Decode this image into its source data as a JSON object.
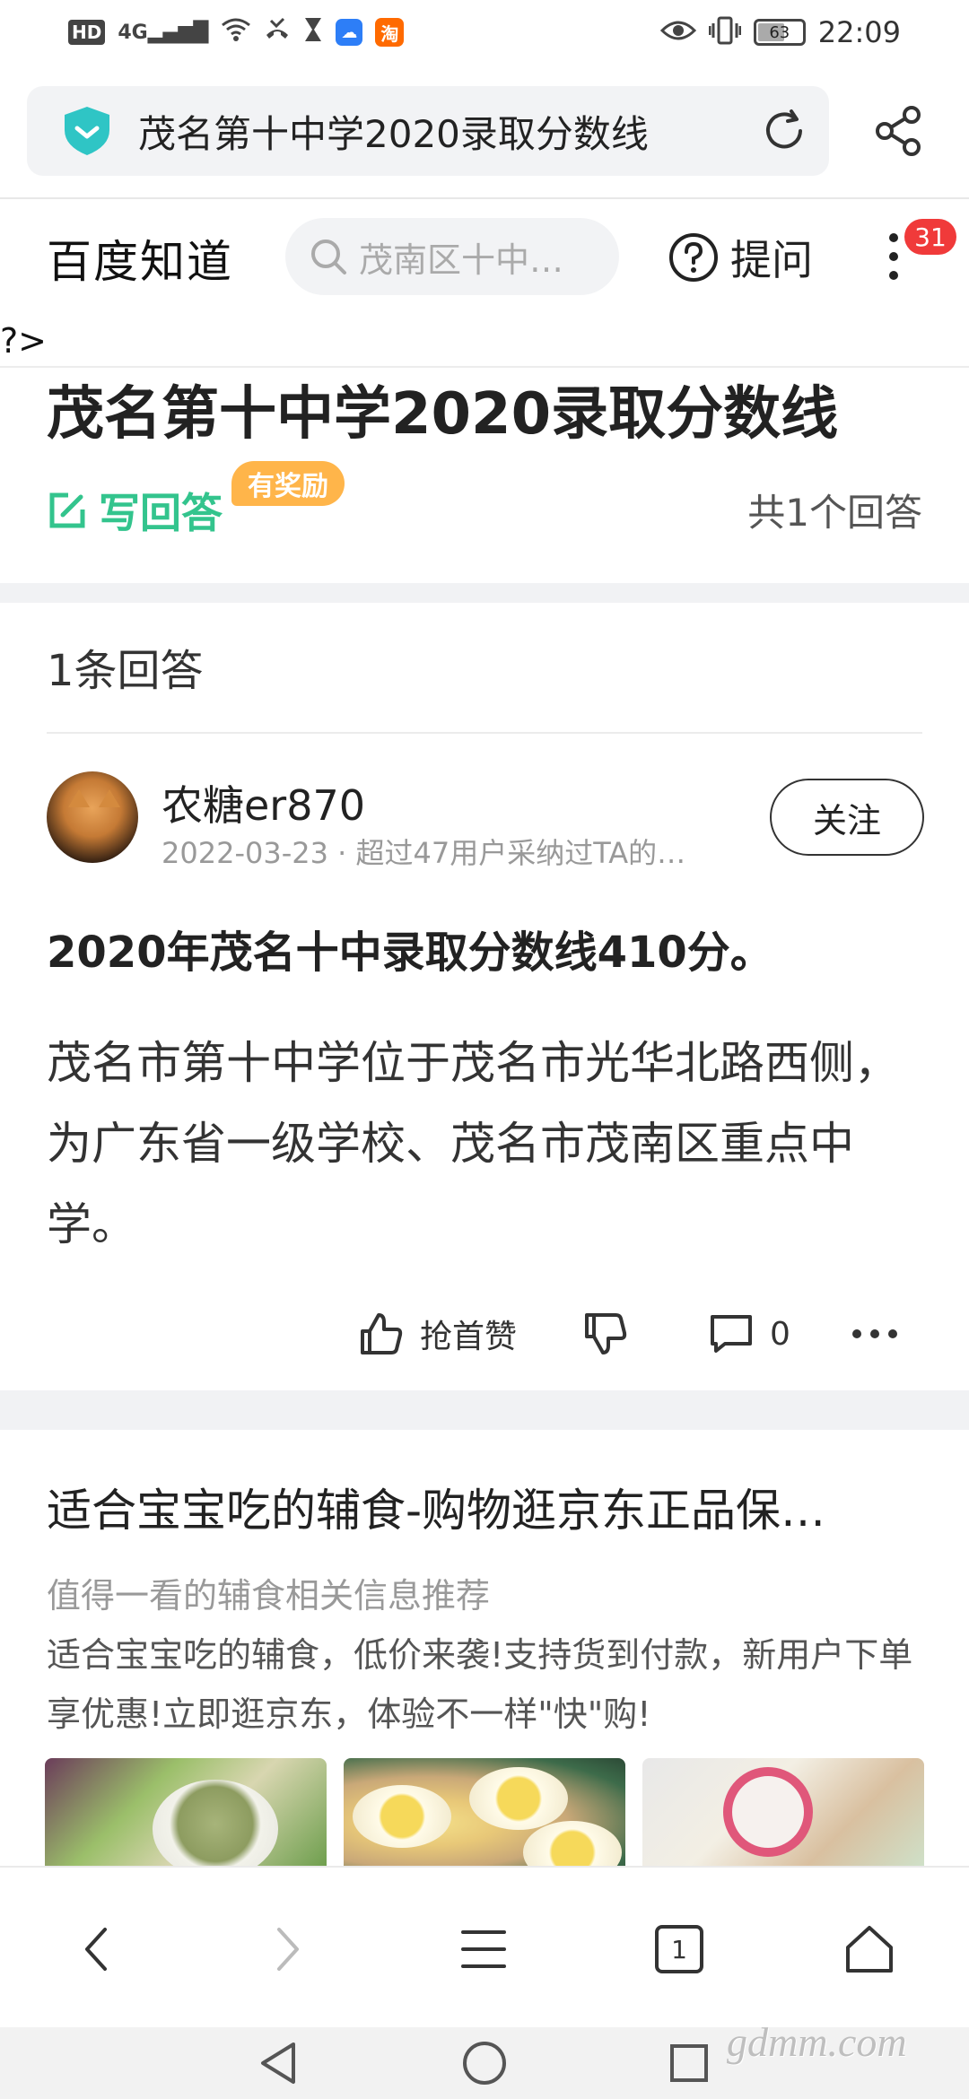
{
  "status_bar": {
    "hd": "HD",
    "network": "4G",
    "time": "22:09",
    "battery": "63",
    "battery_level_percent": 63,
    "taobao_icon_text": "淘"
  },
  "browser": {
    "url_text": "茂名第十中学2020录取分数线",
    "tab_count": "1"
  },
  "header": {
    "logo": "百度知道",
    "search_placeholder": "茂南区十中…",
    "ask_label": "提问",
    "notification_count": "31",
    "stray_text": "?>"
  },
  "question": {
    "title": "茂名第十中学2020录取分数线",
    "write_answer": "写回答",
    "reward_badge": "有奖励",
    "answer_count": "共1个回答"
  },
  "answers": {
    "heading": "1条回答",
    "author": {
      "name": "农糖er870",
      "meta": "2022-03-23 · 超过47用户采纳过TA的…"
    },
    "follow_label": "关注",
    "bold_line": "2020年茂名十中录取分数线410分。",
    "body": "茂名市第十中学位于茂名市光华北路西侧，为广东省一级学校、茂名市茂南区重点中学。",
    "like_label": "抢首赞",
    "comment_count": "0"
  },
  "ad": {
    "title": "适合宝宝吃的辅食-购物逛京东正品保…",
    "subtitle": "值得一看的辅食相关信息推荐",
    "description": "适合宝宝吃的辅食，低价来袭!支持货到付款，新用户下单享优惠!立即逛京东，体验不一样\"快\"购!"
  },
  "watermark": "gdmm.com",
  "colors": {
    "accent_green": "#33c48d",
    "reward_orange": "#ffb54a",
    "badge_red": "#f03a3a",
    "shield_teal": "#2fc5c5"
  }
}
